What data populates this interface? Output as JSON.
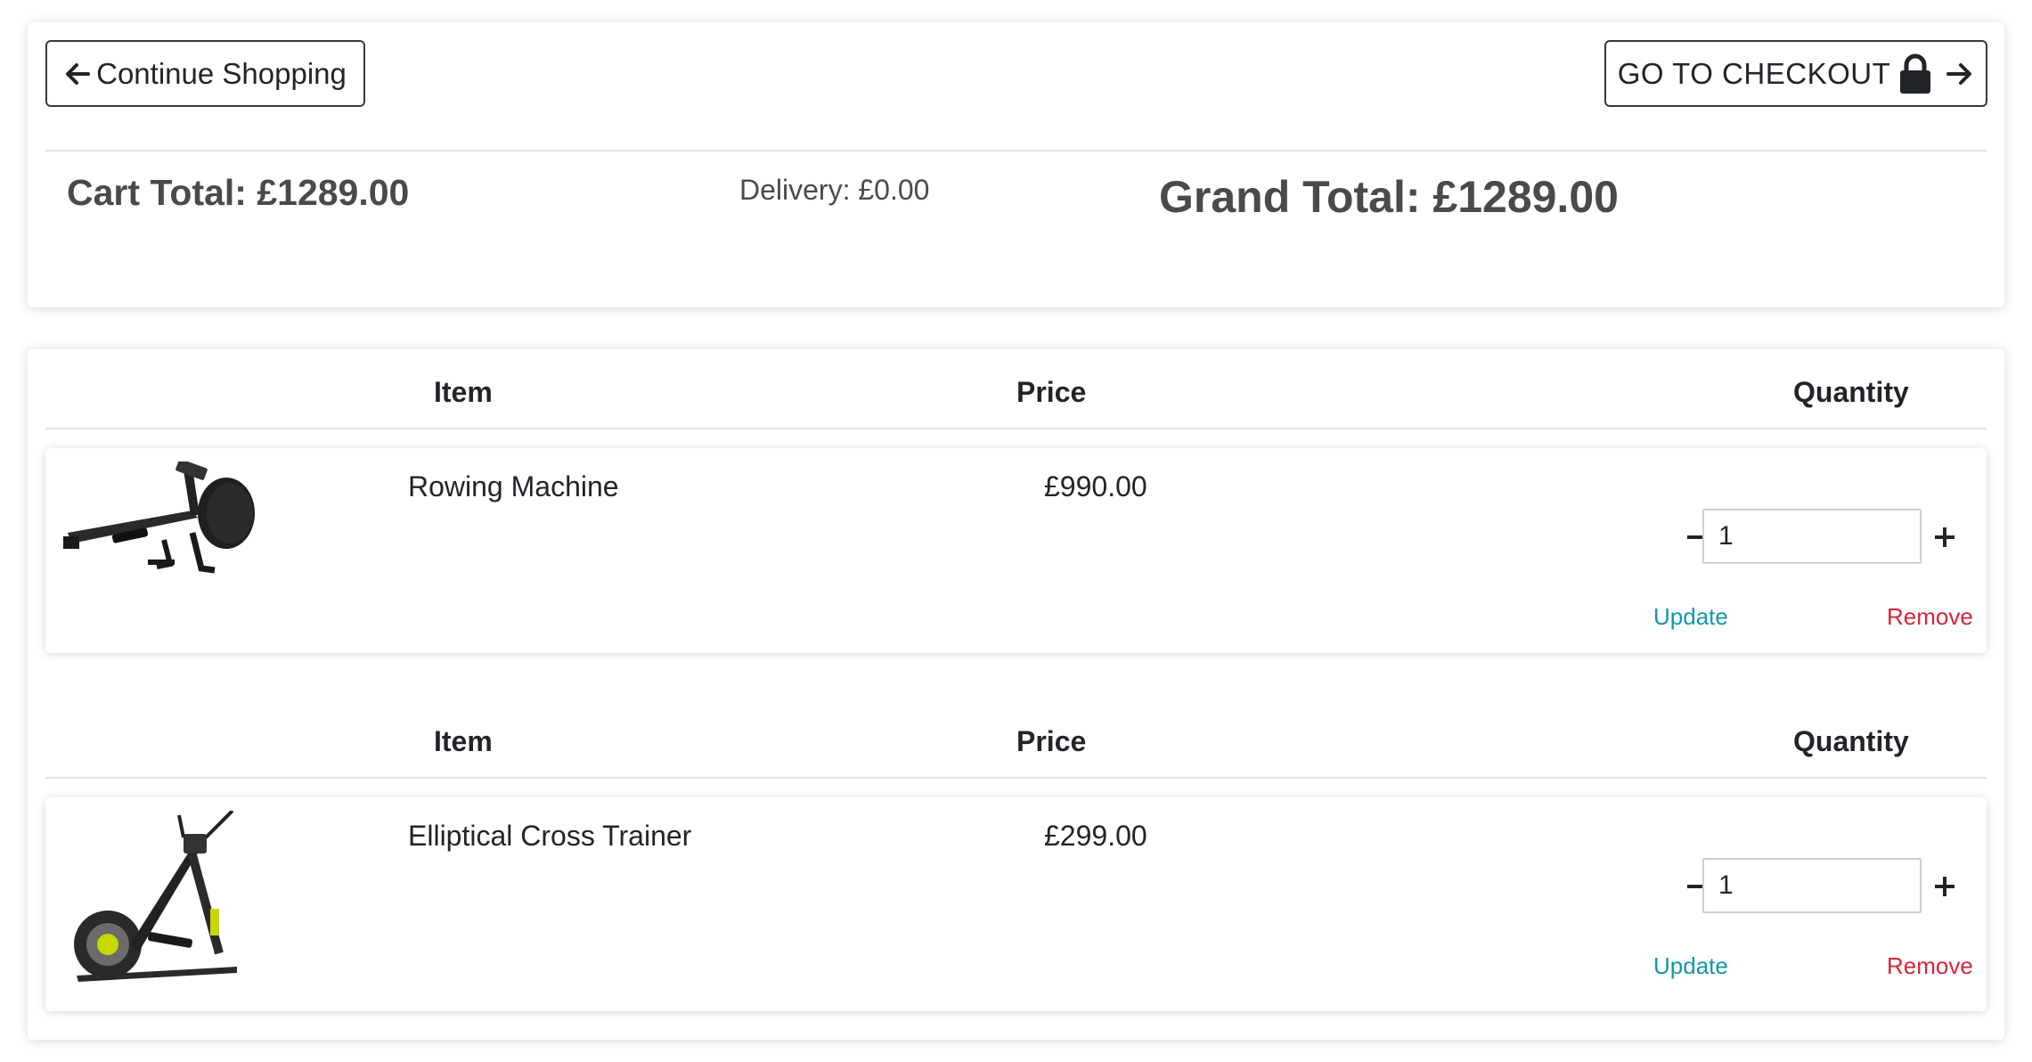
{
  "summary": {
    "continue_label": "Continue Shopping",
    "checkout_label": "GO TO CHECKOUT",
    "cart_total": "Cart Total: £1289.00",
    "delivery": "Delivery: £0.00",
    "grand_total": "Grand Total: £1289.00"
  },
  "table_headers": {
    "item": "Item",
    "price": "Price",
    "quantity": "Quantity"
  },
  "items": [
    {
      "name": "Rowing Machine",
      "price": "£990.00",
      "quantity": "1",
      "update_label": "Update",
      "remove_label": "Remove"
    },
    {
      "name": "Elliptical Cross Trainer",
      "price": "£299.00",
      "quantity": "1",
      "update_label": "Update",
      "remove_label": "Remove"
    }
  ],
  "icons": {
    "continue": "arrow-left-icon",
    "checkout_lock": "lock-icon",
    "checkout_arrow": "arrow-right-icon",
    "minus": "minus-icon",
    "plus": "plus-icon"
  },
  "colors": {
    "update_link": "#1496a8",
    "remove_link": "#d6253d",
    "button_border": "#343a40"
  }
}
